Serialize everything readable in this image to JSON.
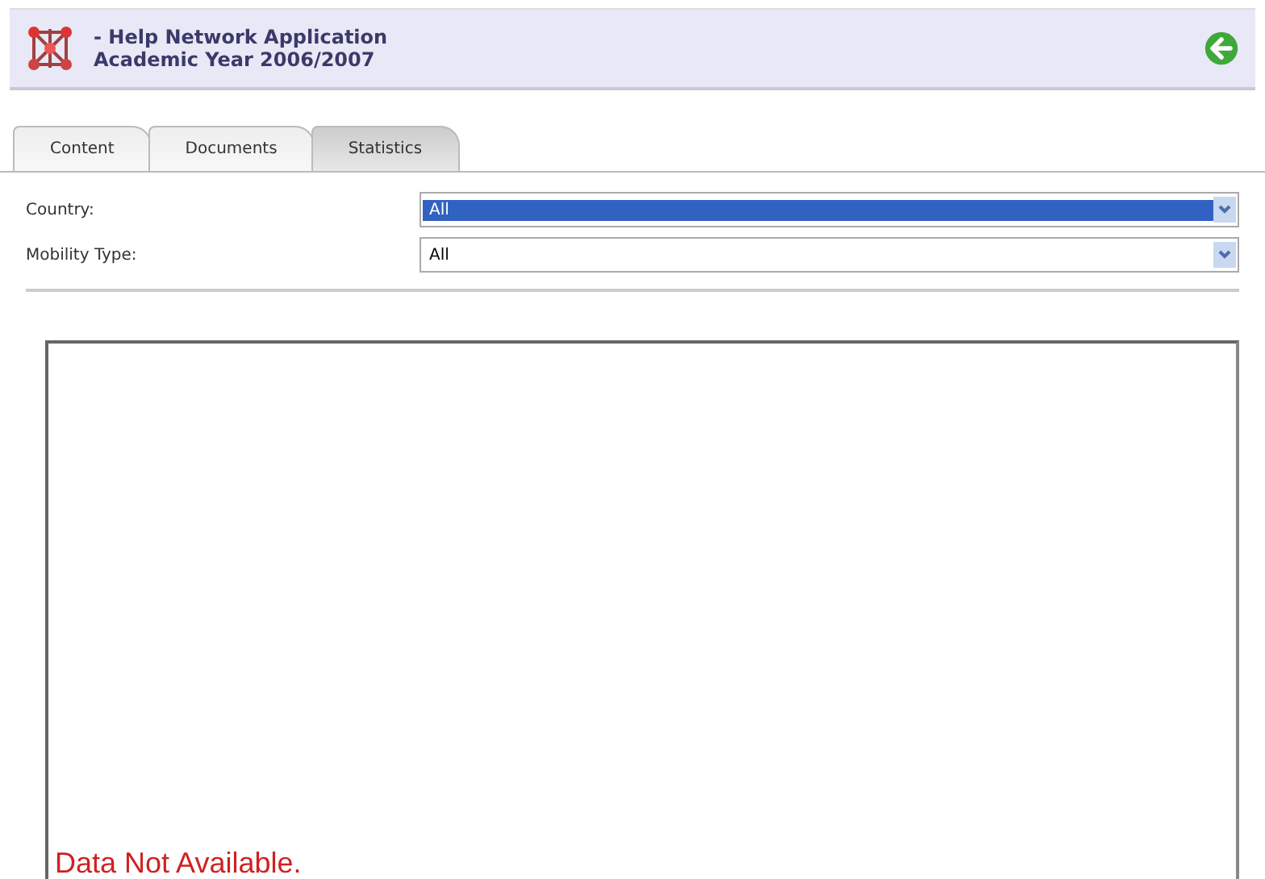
{
  "header": {
    "title": "- Help Network Application",
    "subtitle": "Academic Year 2006/2007"
  },
  "tabs": [
    {
      "label": "Content",
      "selected": false
    },
    {
      "label": "Documents",
      "selected": false
    },
    {
      "label": "Statistics",
      "selected": true
    }
  ],
  "filters": [
    {
      "label": "Country:",
      "value": "All",
      "highlighted": true
    },
    {
      "label": "Mobility Type:",
      "value": "All",
      "highlighted": false
    }
  ],
  "chart_panel": {
    "message": "Data Not Available."
  }
}
